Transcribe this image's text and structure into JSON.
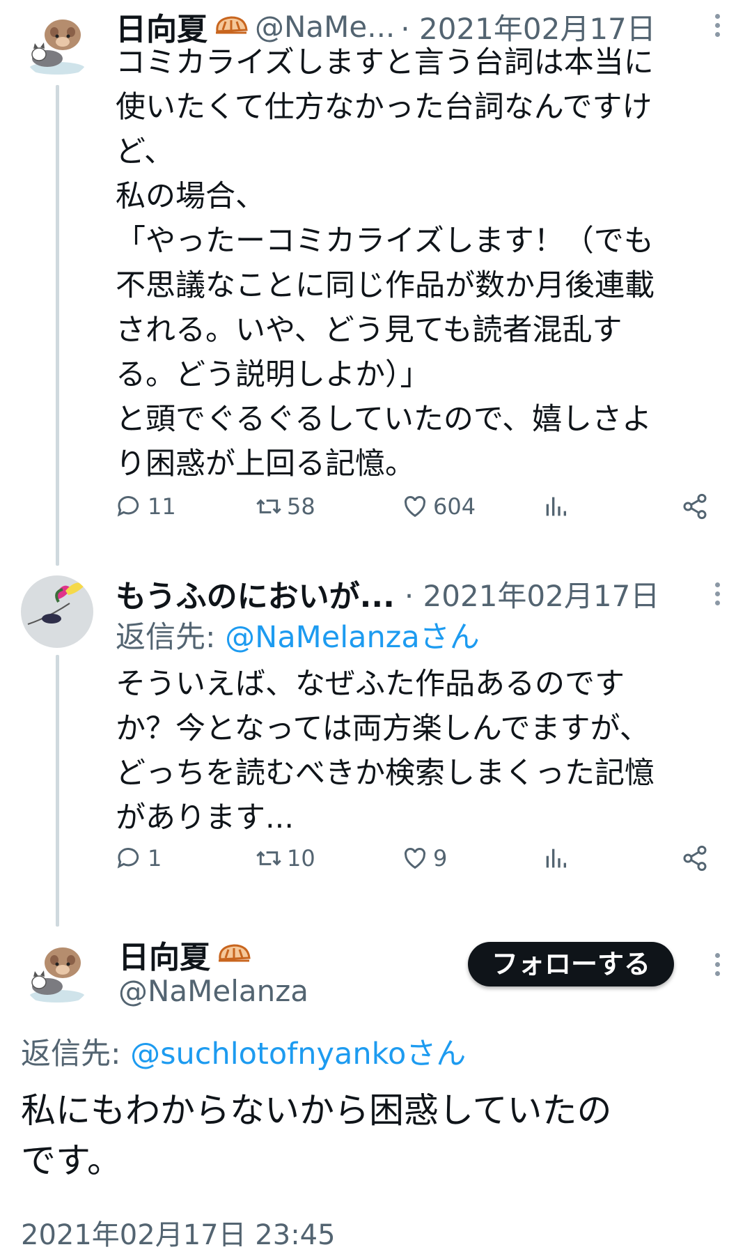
{
  "colors": {
    "accent": "#1d9bf0",
    "secondary": "#536471",
    "text": "#0f1419"
  },
  "tweet1": {
    "display_name": "日向夏",
    "handle": "@NaMe...",
    "date": "· 2021年02月17日",
    "body": "コミカライズしますと言う台詞は本当に\n使いたくて仕方なかった台詞なんですけ\nど、\n私の場合、\n「やったーコミカライズします！（でも\n不思議なことに同じ作品が数か月後連載\nされる。いや、どう見ても読者混乱す\nる。どう説明しよか）」\nと頭でぐるぐるしていたので、嬉しさよ\nり困惑が上回る記憶。",
    "replies": "11",
    "retweets": "58",
    "likes": "604"
  },
  "tweet2": {
    "display_name": "もうふのにおいが...",
    "date": "· 2021年02月17日",
    "reply_prefix": "返信先: ",
    "reply_mention": "@NaMelanzaさん",
    "body": "そういえば、なぜふた作品あるのです\nか？今となっては両方楽しんでますが、\nどっちを読むべきか検索しまくった記憶\nがあります...",
    "replies": "1",
    "retweets": "10",
    "likes": "9"
  },
  "tweet3": {
    "display_name": "日向夏",
    "handle": "@NaMelanza",
    "follow_label": "フォローする",
    "reply_prefix": "返信先: ",
    "reply_mention": "@suchlotofnyankoさん",
    "body": "私にもわからないから困惑していたの\nです。",
    "timestamp": "2021年02月17日 23:45"
  },
  "icons": [
    "reply-icon",
    "retweet-icon",
    "like-icon",
    "views-icon",
    "share-icon",
    "more-icon",
    "badge-icon"
  ]
}
